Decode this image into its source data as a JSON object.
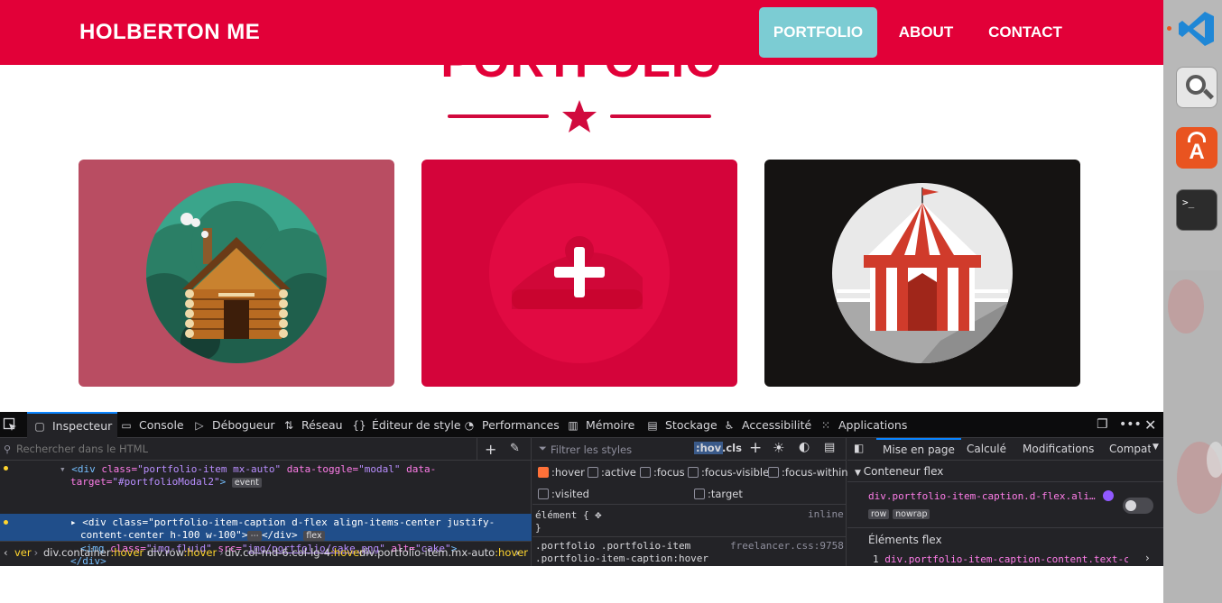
{
  "navbar": {
    "brand": "HOLBERTON ME",
    "links": [
      "PORTFOLIO",
      "ABOUT",
      "CONTACT"
    ],
    "active": "PORTFOLIO",
    "colors": {
      "bar": "#e20038",
      "active": "#7cccd3"
    }
  },
  "portfolio": {
    "heading": "PORTFOLIO",
    "items": [
      {
        "name": "cabin",
        "bg": "#b94d62"
      },
      {
        "name": "cake",
        "bg": "#d4043a"
      },
      {
        "name": "circus",
        "bg": "#151312"
      }
    ]
  },
  "devtools": {
    "tabs": [
      "Inspecteur",
      "Console",
      "Débogueur",
      "Réseau",
      "Éditeur de style",
      "Performances",
      "Mémoire",
      "Stockage",
      "Accessibilité",
      "Applications"
    ],
    "active_tab": "Inspecteur",
    "html_search_placeholder": "Rechercher dans le HTML",
    "html_lines": {
      "l1_open": "<div ",
      "l1_class_attr": "class=",
      "l1_class_val": "\"portfolio-item mx-auto\"",
      "l1_toggle_attr": " data-toggle=",
      "l1_toggle_val": "\"modal\"",
      "l1_data_attr": " data-",
      "l2_target_attr": "target=",
      "l2_target_val": "\"#portfolioModal2\"",
      "l2_close": ">",
      "l2_badge": "event",
      "l3_open": "<div ",
      "l3_class_attr": "class=",
      "l3_class_val": "\"portfolio-item-caption d-flex align-items-center justify-",
      "l4_class_val": "content-center h-100 w-100\"",
      "l4_mid": ">",
      "l4_ellipsis": "⋯",
      "l4_close": "</div>",
      "l4_badge": "flex",
      "l5_open": "<img ",
      "l5_class_attr": "class=",
      "l5_class_val": "\"img-fluid\"",
      "l5_src_attr": " src=",
      "l5_src_q1": "\"",
      "l5_src_val": "img/portfolio/cake.png",
      "l5_src_q2": "\"",
      "l5_alt_attr": " alt=",
      "l5_alt_val": "\"cake\"",
      "l5_close": ">",
      "l6": "</div>"
    },
    "breadcrumbs": [
      {
        "el": "ver",
        "state": ""
      },
      {
        "el": "div.container",
        "state": ":hover"
      },
      {
        "el": "div.row",
        "state": ":hover"
      },
      {
        "el": "div.col-md-6.col-lg-4",
        "state": ":hover"
      },
      {
        "el": "div.portfolio-item.mx-auto",
        "state": ":hover"
      }
    ],
    "rules": {
      "filter_placeholder": "Filtrer les styles",
      "hov": ":hov",
      "cls": ".cls",
      "pseudo_classes": [
        ":hover",
        ":active",
        ":focus",
        ":focus-visible",
        ":focus-within",
        ":visited",
        ":target"
      ],
      "element_rule": "élément {",
      "element_source": "inline",
      "element_close": "}",
      "rule_selector_1": ".portfolio .portfolio-item",
      "rule_selector_2": ".portfolio-item-caption:hover",
      "rule_source": "freelancer.css:9758"
    },
    "layout": {
      "tabs": [
        "Mise en page",
        "Calculé",
        "Modifications",
        "Compati"
      ],
      "flex_container_title": "Conteneur flex",
      "flex_container_selector": "div.portfolio-item-caption.d-flex.ali…",
      "badges": [
        "row",
        "nowrap"
      ],
      "flex_items_title": "Éléments flex",
      "flex_item_index": "1",
      "flex_item_selector": "div.portfolio-item-caption-content.text-ce…"
    }
  },
  "dock": {
    "apps": [
      "vscode",
      "image-viewer",
      "software-center",
      "terminal"
    ]
  }
}
